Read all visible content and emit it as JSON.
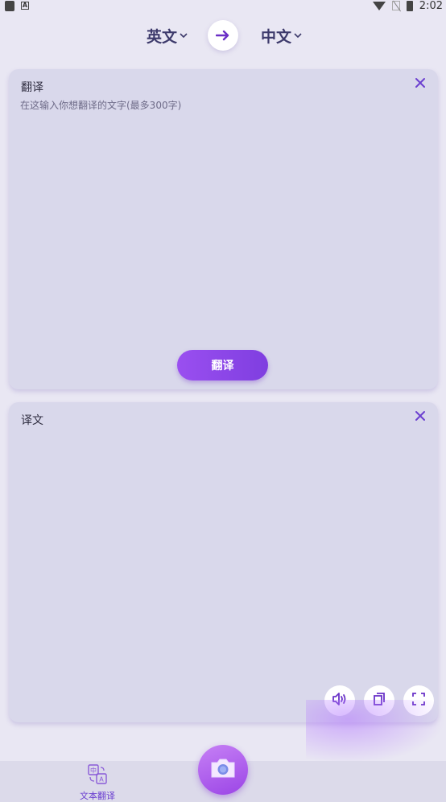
{
  "status_bar": {
    "time": "2:02"
  },
  "language_bar": {
    "source_lang": "英文",
    "target_lang": "中文",
    "swap_icon": "arrow-right-icon"
  },
  "input_card": {
    "title": "翻译",
    "placeholder": "在这输入你想翻译的文字(最多300字)",
    "value": "",
    "translate_button": "翻译",
    "close_icon": "close-icon"
  },
  "output_card": {
    "title": "译文",
    "result": "",
    "actions": [
      "speaker-icon",
      "copy-icon",
      "fullscreen-icon"
    ]
  },
  "bottom_nav": {
    "items": [
      {
        "label": "文本翻译",
        "icon": "translate-icon"
      }
    ],
    "camera_icon": "camera-icon"
  },
  "colors": {
    "accent": "#7f3ee0",
    "card": "#d9d8eb",
    "background": "#e9e7f3"
  }
}
